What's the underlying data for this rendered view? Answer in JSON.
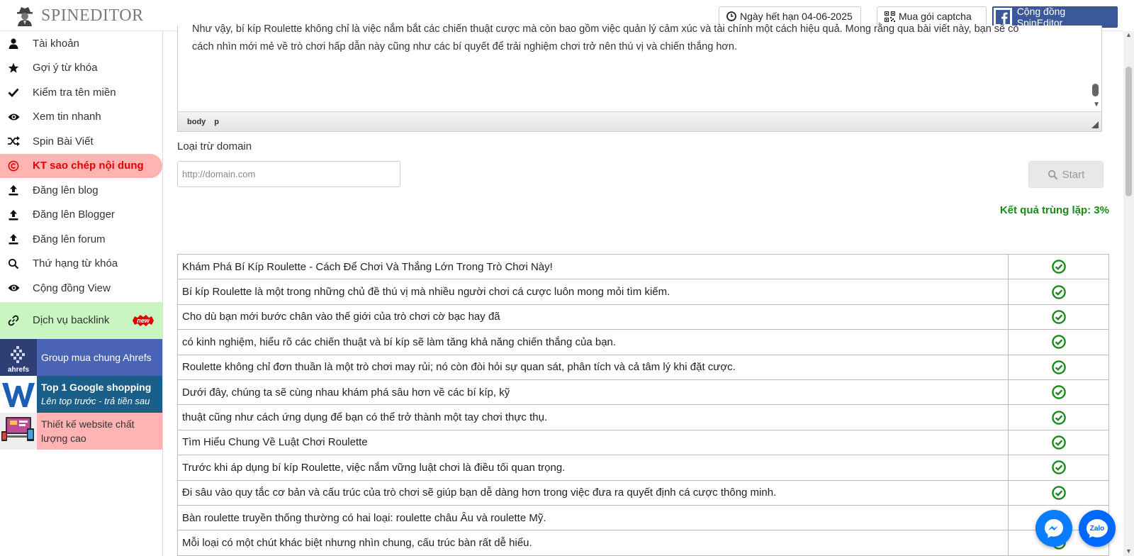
{
  "header": {
    "logo_text": "SPINEDITOR",
    "expire_label": "Ngày hết hạn 04-06-2025",
    "captcha_label": "Mua gói captcha",
    "community_label": "Cộng đồng SpinEditor"
  },
  "sidebar": {
    "items": [
      {
        "label": "Tài khoản",
        "icon": "user-icon"
      },
      {
        "label": "Gợi ý từ khóa",
        "icon": "star-icon"
      },
      {
        "label": "Kiểm tra tên miền",
        "icon": "check-icon"
      },
      {
        "label": "Xem tin nhanh",
        "icon": "eye-icon"
      },
      {
        "label": "Spin Bài Viết",
        "icon": "shuffle-icon"
      },
      {
        "label": "KT sao chép nội dung",
        "icon": "copyright-icon",
        "active": true
      },
      {
        "label": "Đăng lên blog",
        "icon": "upload-icon"
      },
      {
        "label": "Đăng lên Blogger",
        "icon": "upload-icon"
      },
      {
        "label": "Đăng lên forum",
        "icon": "upload-icon"
      },
      {
        "label": "Thứ hạng từ khóa",
        "icon": "search-icon"
      },
      {
        "label": "Cộng đồng View",
        "icon": "eye-icon"
      }
    ],
    "backlink_label": "Dịch vụ backlink",
    "new_badge": "new",
    "promos": {
      "ahrefs": {
        "logo_text": "ahrefs",
        "label": "Group mua chung Ahrefs"
      },
      "top1": {
        "title": "Top 1 Google shopping",
        "subtitle": "Lên top trước - trả tiền sau"
      },
      "web": {
        "label": "Thiết kế website chất lượng cao"
      }
    }
  },
  "editor": {
    "text_line1": "Như vậy, bí kíp Roulette không chỉ là việc nắm bắt các chiến thuật cược mà còn bao gồm việc quản lý cảm xúc và tài chính một cách hiệu quả. Mong rằng qua bài viết này, bạn sẽ có",
    "text_line2": "cách nhìn mới mẻ về trò chơi hấp dẫn này cũng như các bí quyết để trải nghiệm chơi trở nên thú vị và chiến thắng hơn.",
    "path_body": "body",
    "path_p": "p"
  },
  "form": {
    "exclude_label": "Loại trừ domain",
    "domain_placeholder": "http://domain.com",
    "start_label": "Start"
  },
  "result": {
    "label": "Kết quả trùng lặp: 3%"
  },
  "sentences": [
    "Khám Phá Bí Kíp Roulette - Cách Để Chơi Và Thắng Lớn Trong Trò Chơi Này!",
    "Bí kíp Roulette là một trong những chủ đề thú vị mà nhiều người chơi cá cược luôn mong mỏi tìm kiếm.",
    "Cho dù bạn mới bước chân vào thế giới của trò chơi cờ bạc hay đã",
    "có kinh nghiệm, hiểu rõ các chiến thuật và bí kíp sẽ làm tăng khả năng chiến thắng của bạn.",
    "Roulette không chỉ đơn thuần là một trò chơi may rủi; nó còn đòi hỏi sự quan sát, phân tích và cả tâm lý khi đặt cược.",
    "Dưới đây, chúng ta sẽ cùng nhau khám phá sâu hơn về các bí kíp, kỹ",
    "thuật cũng như cách ứng dụng để bạn có thể trở thành một tay chơi thực thụ.",
    "Tìm Hiểu Chung Về Luật Chơi Roulette",
    "Trước khi áp dụng bí kíp Roulette, việc nắm vững luật chơi là điều tối quan trọng.",
    "Đi sâu vào quy tắc cơ bản và cấu trúc của trò chơi sẽ giúp bạn dễ dàng hơn trong việc đưa ra quyết định cá cược thông minh.",
    "Bàn roulette truyền thống thường có hai loại: roulette châu Âu và roulette Mỹ.",
    "Mỗi loại có một chút khác biệt nhưng nhìn chung, cấu trúc bàn rất dễ hiểu."
  ],
  "floating": {
    "zalo_label": "Zalo"
  },
  "colors": {
    "active_bg": "#ffb3b3",
    "active_text": "#e60000",
    "check_green": "#1a8a1a",
    "facebook_blue": "#3b5998"
  }
}
